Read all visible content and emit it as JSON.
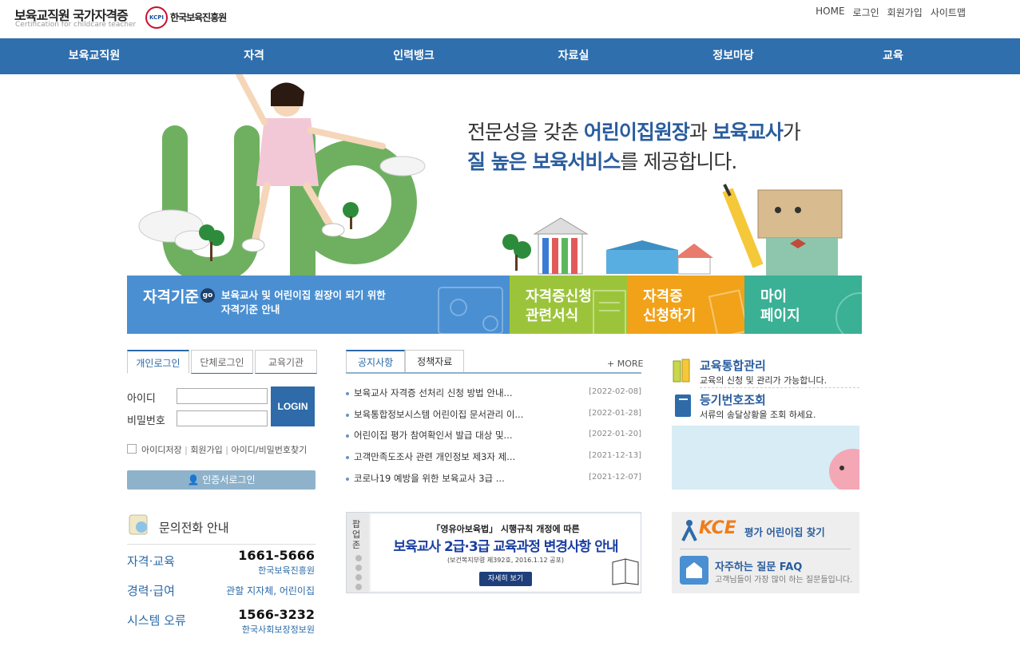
{
  "header": {
    "site_title": "보육교직원 국가자격증",
    "site_subtitle": "Certification for childcare teacher",
    "org_logo_text": "KCPI",
    "org_name": "한국보육진흥원",
    "top_links": [
      "HOME",
      "로그인",
      "회원가입",
      "사이트맵"
    ]
  },
  "gnb": [
    "보육교직원",
    "자격",
    "인력뱅크",
    "자료실",
    "정보마당",
    "교육"
  ],
  "hero": {
    "slogan_line1": [
      "전문성을 갖춘 ",
      "어린이집원장",
      "과 ",
      "보육교사",
      "가"
    ],
    "slogan_line2": [
      "질 높은 보육서비스",
      "를 제공합니다."
    ]
  },
  "quick": {
    "qualification": {
      "title": "자격기준",
      "badge": "go",
      "desc1": "보육교사 및 어린이집 원장이 되기 위한",
      "desc2": "자격기준 안내"
    },
    "forms": {
      "title1": "자격증신청",
      "title2": "관련서식"
    },
    "apply": {
      "title1": "자격증",
      "title2": "신청하기"
    },
    "mypage": {
      "title1": "마이",
      "title2": "페이지"
    }
  },
  "login": {
    "tabs": [
      "개인로그인",
      "단체로그인",
      "교육기관"
    ],
    "id_label": "아이디",
    "pw_label": "비밀번호",
    "login_button": "LOGIN",
    "remember_label": "아이디저장",
    "join_link": "회원가입",
    "find_link": "아이디/비밀번호찾기",
    "cert_login": "인증서로그인"
  },
  "contact": {
    "title": "문의전화 안내",
    "rows": [
      {
        "label": "자격·교육",
        "number": "1661-5666",
        "org": "한국보육진흥원"
      },
      {
        "label": "경력·급여",
        "number": "",
        "org": "관할 지자체, 어린이집"
      },
      {
        "label": "시스템 오류",
        "number": "1566-3232",
        "org": "한국사회보장정보원"
      }
    ]
  },
  "notices": {
    "tabs": [
      "공지사항",
      "정책자료"
    ],
    "more": "+ MORE",
    "items": [
      {
        "title": "보육교사 자격증 선처리 신청 방법 안내...",
        "date": "[2022-02-08]"
      },
      {
        "title": "보육통합정보시스템 어린이집 문서관리 이...",
        "date": "[2022-01-28]"
      },
      {
        "title": "어린이집 평가 참여확인서 발급 대상 및...",
        "date": "[2022-01-20]"
      },
      {
        "title": "고객만족도조사 관련 개인정보 제3자 제...",
        "date": "[2021-12-13]"
      },
      {
        "title": "코로나19 예방을 위한 보육교사 3급 ...",
        "date": "[2021-12-07]"
      }
    ]
  },
  "popup": {
    "side_label": "팝업존",
    "line1": "「영유아보육법」 시행규칙 개정에 따른",
    "line2": "보육교사 2급·3급 교육과정 변경사항 안내",
    "line3": "(보건복지부령 제392호, 2016.1.12 공포)",
    "button": "자세히 보기"
  },
  "right": {
    "edu_title": "교육통합관리",
    "edu_desc": "교육의 신청 및 관리가 가능합니다.",
    "reg_title": "등기번호조회",
    "reg_desc": "서류의 송달상황을 조회 하세요.",
    "kce_logo": "KCE",
    "kce_label": "평가 어린이집 찾기",
    "faq_title": "자주하는 질문 FAQ",
    "faq_desc": "고객님들이 가장 많이 하는 질문들입니다."
  }
}
